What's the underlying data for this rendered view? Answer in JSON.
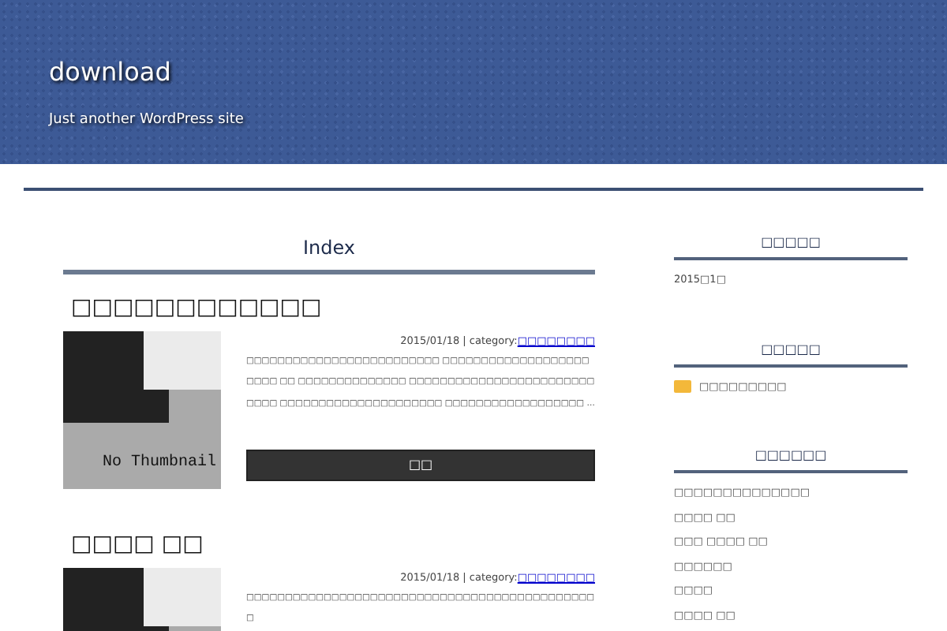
{
  "site": {
    "title": "download",
    "tagline": "Just another WordPress site"
  },
  "main": {
    "heading": "Index",
    "posts": [
      {
        "title": "□□□□□□□□□□□□",
        "meta": "2015/01/18 | category:",
        "category": "□□□□□□□□",
        "thumbnail": {
          "kind": "placeholder",
          "label": "No Thumbnail"
        },
        "excerpt": "□□□□□□□□□□□□□□□□□□□□□□□□□ □□□□□□□□□□□□□□□□□□□□□□□ □□ □□□□□□□□□□□□□□ □□□□□□□□□□□□□□□□□□□□□□□□□□□□ □□□□□□□□□□□□□□□□□□□□□ □□□□□□□□□□□□□□□□□□ …",
        "button": "□□"
      },
      {
        "title": "□□□□ □□",
        "meta": "2015/01/18 | category:",
        "category": "□□□□□□□□",
        "thumbnail": {
          "kind": "placeholder"
        },
        "excerpt": "□□□□□□□□□□□□□□□□□□□□□□□□□□□□□□□□□□□□□□□□□□□□□□"
      }
    ]
  },
  "sidebar": [
    {
      "heading": "□□□□□",
      "kind": "archive",
      "items": [
        "2015□1□"
      ]
    },
    {
      "heading": "□□□□□",
      "kind": "category",
      "items": [
        "□□□□□□□□□"
      ]
    },
    {
      "heading": "□□□□□□",
      "kind": "recent",
      "items": [
        "□□□□□□□□□□□□□□",
        "□□□□ □□",
        "□□□ □□□□ □□",
        "□□□□□□",
        "□□□□",
        "□□□□ □□"
      ]
    }
  ]
}
